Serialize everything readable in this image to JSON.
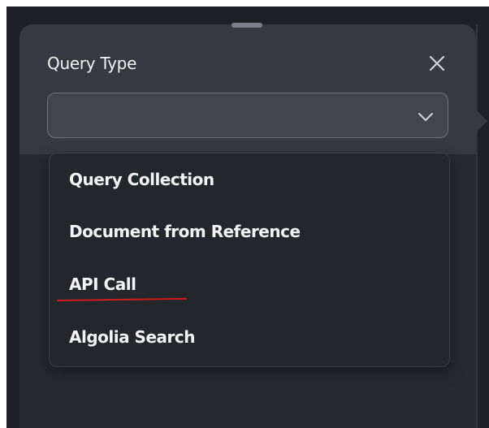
{
  "dialog": {
    "title": "Query Type",
    "close_icon": "close-icon"
  },
  "select": {
    "value": "",
    "chevron_icon": "chevron-down-icon"
  },
  "menu": {
    "items": [
      {
        "label": "Query Collection"
      },
      {
        "label": "Document from Reference"
      },
      {
        "label": "API Call"
      },
      {
        "label": "Algolia Search"
      }
    ]
  },
  "colors": {
    "background": "#1d2024",
    "panel": "#353a40",
    "menu": "#23272c",
    "text": "#f4f4f4",
    "annotation": "#d11a1a"
  }
}
